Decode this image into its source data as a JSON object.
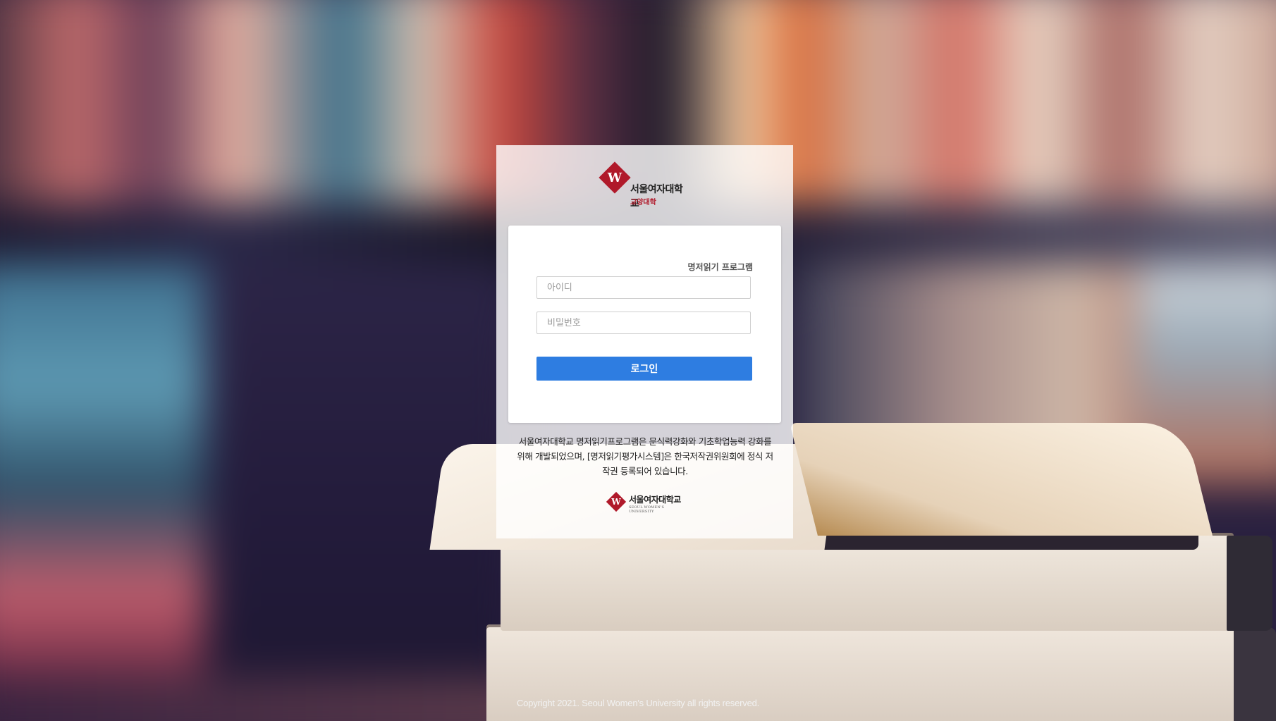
{
  "brand": {
    "university_name": "서울여자대학교",
    "college_name": "교양대학",
    "english_name": "SEOUL WOMEN'S UNIVERSITY",
    "accent_color": "#b0192a"
  },
  "login": {
    "program_label": "명저읽기 프로그램",
    "id_placeholder": "아이디",
    "password_placeholder": "비밀번호",
    "button_label": "로그인",
    "button_color": "#2e7de1"
  },
  "description": "서울여자대학교 명저읽기프로그램은 문식력강화와 기초학업능력 강화를 위해 개발되었으며, [명저읽기평가시스템]은 한국저작권위원회에 정식 저작권 등록되어 있습니다.",
  "footer": {
    "copyright": "Copyright 2021. Seoul Women's University all rights reserved."
  }
}
